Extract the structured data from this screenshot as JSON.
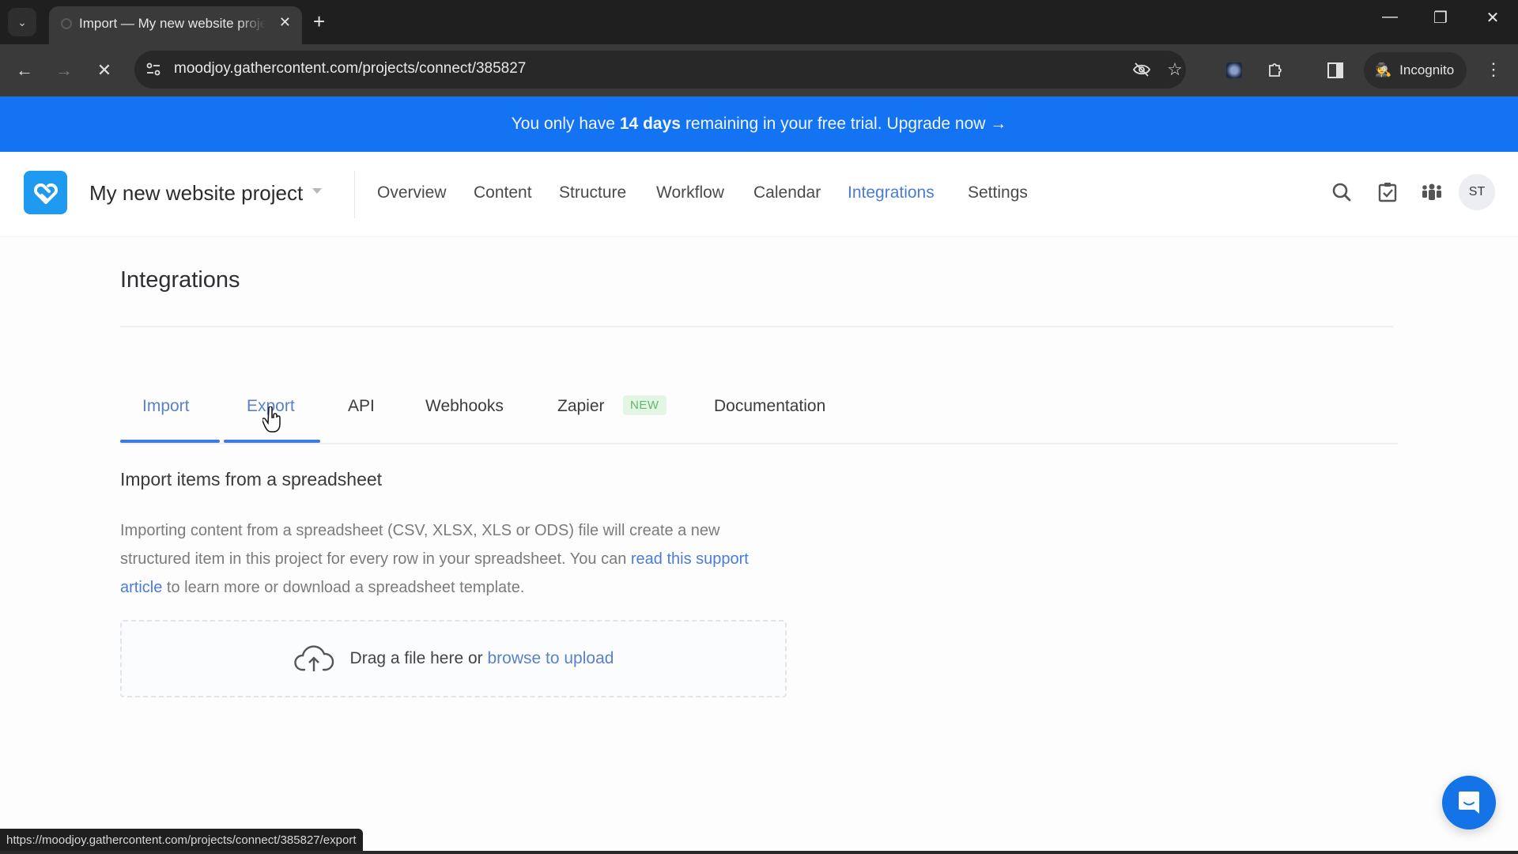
{
  "browser": {
    "tab_title": "Import — My new website project",
    "new_tab_icon": "plus-icon",
    "url": "moodjoy.gathercontent.com/projects/connect/385827",
    "incognito_label": "Incognito",
    "status_url": "https://moodjoy.gathercontent.com/projects/connect/385827/export",
    "window_controls": [
      "minimize",
      "restore",
      "close"
    ]
  },
  "banner": {
    "prefix": "You only have",
    "highlight": "14 days",
    "suffix": "remaining in your free trial.",
    "cta": "Upgrade now →",
    "color": "#1473f2"
  },
  "header": {
    "project_name": "My new website project",
    "nav": [
      {
        "label": "Overview",
        "active": false
      },
      {
        "label": "Content",
        "active": false
      },
      {
        "label": "Structure",
        "active": false
      },
      {
        "label": "Workflow",
        "active": false
      },
      {
        "label": "Calendar",
        "active": false
      },
      {
        "label": "Integrations",
        "active": true
      },
      {
        "label": "Settings",
        "active": false
      }
    ],
    "icons": [
      "search-icon",
      "tasks-icon",
      "team-icon"
    ],
    "avatar_initials": "ST",
    "accent": "#4a7cd6"
  },
  "page": {
    "title": "Integrations",
    "tabs": [
      {
        "label": "Import",
        "active": true
      },
      {
        "label": "Export",
        "hover": true
      },
      {
        "label": "API"
      },
      {
        "label": "Webhooks"
      },
      {
        "label": "Zapier",
        "badge": "NEW"
      },
      {
        "label": "Documentation"
      }
    ],
    "section_title": "Import items from a spreadsheet",
    "description": {
      "text_before": "Importing content from a spreadsheet (CSV, XLSX, XLS or ODS) file will create a new structured item in this project for every row in your spreadsheet. You can ",
      "link": "read this support article",
      "text_after": " to learn more or download a spreadsheet template."
    },
    "dropzone": {
      "text": "Drag a file here or",
      "link": "browse to upload"
    }
  }
}
